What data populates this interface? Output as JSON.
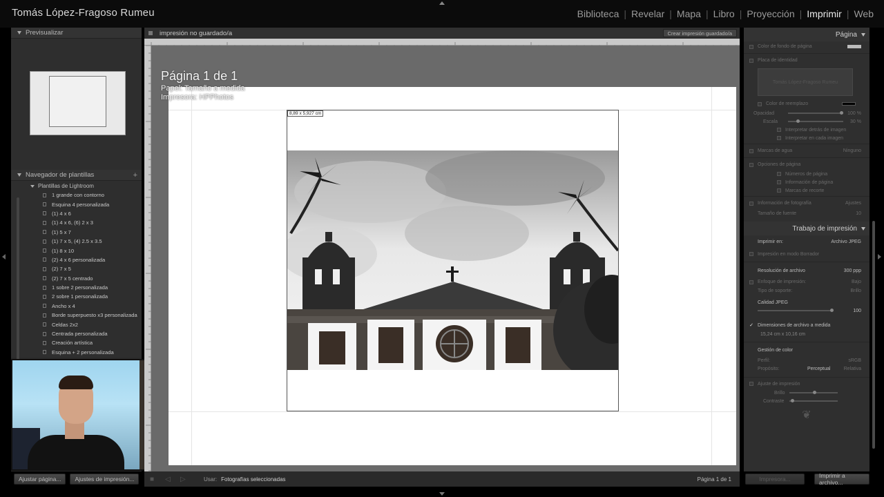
{
  "identity_plate": "Tomás López-Fragoso Rumeu",
  "modules": [
    {
      "label": "Biblioteca",
      "active": false
    },
    {
      "label": "Revelar",
      "active": false
    },
    {
      "label": "Mapa",
      "active": false
    },
    {
      "label": "Libro",
      "active": false
    },
    {
      "label": "Proyección",
      "active": false
    },
    {
      "label": "Imprimir",
      "active": true
    },
    {
      "label": "Web",
      "active": false
    }
  ],
  "left_panel": {
    "preview_header": "Previsualizar",
    "template_nav_header": "Navegador de plantillas",
    "folder": "Plantillas de Lightroom",
    "templates": [
      "1 grande con contorno",
      "Esquina 4 personalizada",
      "(1) 4 x 6",
      "(1) 4 x 6, (6) 2 x 3",
      "(1) 5 x 7",
      "(1) 7 x 5, (4) 2.5 x 3.5",
      "(1) 8 x 10",
      "(2) 4 x 6 personalizada",
      "(2) 7 x 5",
      "(2) 7 x 5 centrado",
      "1 sobre 2 personalizada",
      "2 sobre 1 personalizada",
      "Ancho x 4",
      "Borde superpuesto x3 personalizada",
      "Celdas 2x2",
      "Centrada personalizada",
      "Creación artística",
      "Esquina + 2 personalizada"
    ],
    "buttons": {
      "page_setup": "Ajustar página...",
      "print_settings": "Ajustes de impresión..."
    }
  },
  "center": {
    "collection_title": "impresión no guardado/a",
    "create_saved": "Crear impresión guardado/a",
    "page_title": "Página 1 de 1",
    "paper": "Papel: Tamaño a medida",
    "printer": "Impresora: HPPhotos",
    "cell_dimensions": "8,89 x 5,927 cm"
  },
  "toolbar": {
    "use_label": "Usar:",
    "use_value": "Fotografías seleccionadas",
    "page_count": "Página 1 de 1"
  },
  "right_panel": {
    "page_header": "Página",
    "rows_top": {
      "bg_color": "Color de fondo de página",
      "identity_plate": "Placa de identidad",
      "identity_plate_text": "Tomás López-Fragoso Rumeu",
      "override_color": "Color de reemplazo",
      "opacity": "Opacidad",
      "opacity_value": "100 %",
      "scale": "Escala",
      "scale_value": "30 %",
      "render_behind": "Interpretar detrás de imagen",
      "render_each": "Interpretar en cada imagen",
      "watermark": "Marcas de agua",
      "watermark_value": "Ninguno",
      "page_options": "Opciones de página",
      "page_numbers": "Números de página",
      "page_info": "Información de página",
      "crop_marks": "Marcas de recorte",
      "photo_info": "Información de fotografía",
      "photo_info_value": "Ajustes",
      "font_size": "Tamaño de fuente",
      "font_size_value": "10"
    },
    "print_job_header": "Trabajo de impresión",
    "print_job": {
      "print_to": "Imprimir en:",
      "print_to_value": "Archivo JPEG",
      "draft_mode": "Impresión en modo Borrador",
      "file_resolution": "Resolución de archivo",
      "file_resolution_value": "300 ppp",
      "sharpening": "Enfoque de impresión:",
      "sharpening_value": "Bajo",
      "media_type": "Tipo de soporte:",
      "media_type_value": "Brillo",
      "jpeg_quality": "Calidad JPEG",
      "jpeg_quality_value": "100",
      "custom_dims": "Dimensiones de archivo a medida",
      "custom_dims_values": "15,24 cm   x   10,16 cm",
      "color_management": "Gestión de color",
      "profile": "Perfil:",
      "profile_value": "sRGB",
      "intent": "Propósito:",
      "intent_perceptual": "Perceptual",
      "intent_relative": "Relativa",
      "print_adjust": "Ajuste de impresión",
      "brightness": "Brillo",
      "contrast": "Contraste"
    },
    "buttons": {
      "printer": "Impresora...",
      "print_to_file": "Imprimir a archivo..."
    }
  }
}
